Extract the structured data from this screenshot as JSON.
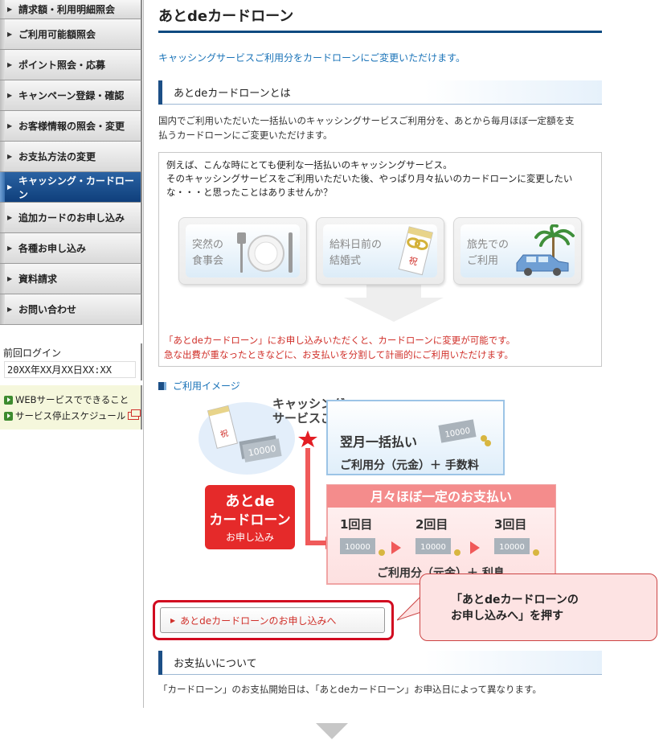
{
  "sidebar": {
    "nav_items": [
      {
        "label": "請求額・利用明細照会",
        "active": false
      },
      {
        "label": "ご利用可能額照会",
        "active": false
      },
      {
        "label": "ポイント照会・応募",
        "active": false
      },
      {
        "label": "キャンペーン登録・確認",
        "active": false
      },
      {
        "label": "お客様情報の照会・変更",
        "active": false
      },
      {
        "label": "お支払方法の変更",
        "active": false
      },
      {
        "label": "キャッシング・カードローン",
        "active": true
      },
      {
        "label": "追加カードのお申し込み",
        "active": false
      },
      {
        "label": "各種お申し込み",
        "active": false
      },
      {
        "label": "資料請求",
        "active": false
      },
      {
        "label": "お問い合わせ",
        "active": false
      }
    ],
    "last_login_label": "前回ログイン",
    "last_login_value": "20XX年XX月XX日XX:XX",
    "links": [
      "WEBサービスでできること",
      "サービス停止スケジュール"
    ]
  },
  "main": {
    "page_title": "あとdeカードローン",
    "lead": "キャッシングサービスご利用分をカードローンにご変更いただけます。",
    "section1": {
      "heading": "あとdeカードローンとは",
      "desc_line1": "国内でご利用いただいた一括払いのキャッシングサービスご利用分を、あとから毎月ほぼ一定額を支",
      "desc_line2": "払うカードローンにご変更いただけます。",
      "example_line1": "例えば、こんな時にとても便利な一括払いのキャッシングサービス。",
      "example_line2": "そのキャッシングサービスをご利用いただいた後、やっぱり月々払いのカードローンに変更したい",
      "example_line3": "な・・・と思ったことはありませんか？",
      "cards": [
        {
          "line1": "突然の",
          "line2": "食事会",
          "icon": "fork-knife-plate-icon"
        },
        {
          "line1": "給料日前の",
          "line2": "結婚式",
          "icon": "gift-envelope-icon"
        },
        {
          "line1": "旅先での",
          "line2": "ご利用",
          "icon": "car-palm-tree-icon"
        }
      ],
      "red_line1": "「あとdeカードローン」にお申し込みいただくと、カードローンに変更が可能です。",
      "red_line2": "急な出費が重なったときなどに、お支払いを分割して計画的にご利用いただけます。"
    },
    "image_section_label": "ご利用イメージ",
    "diagram": {
      "cashing_line1": "キャッシング",
      "cashing_line2": "サービスご利用",
      "lump_title": "翌月一括払い",
      "lump_sub": "ご利用分（元金）＋ 手数料",
      "monthly_title": "月々ほぼ一定のお支払い",
      "installments": [
        "1回目",
        "2回目",
        "3回目"
      ],
      "monthly_sub": "ご利用分（元金）＋ 利息",
      "apply_line1": "あとde",
      "apply_line2": "カードローン",
      "apply_line3": "お申し込み",
      "bill": "10000"
    },
    "apply_button": "あとdeカードローンのお申し込みへ",
    "callout_line1": "「あとdeカードローンの",
    "callout_line2": "お申し込みへ」を押す",
    "section2": {
      "heading": "お支払いについて",
      "desc": "「カードローン」のお支払開始日は、「あとdeカードローン」お申込日によって異なります。"
    }
  },
  "colors": {
    "nav_active": "#0f3f7b",
    "title_rule": "#0d4a80",
    "link_blue": "#1a73b8",
    "alert_red": "#d0302a",
    "highlight_red": "#d10a20"
  }
}
